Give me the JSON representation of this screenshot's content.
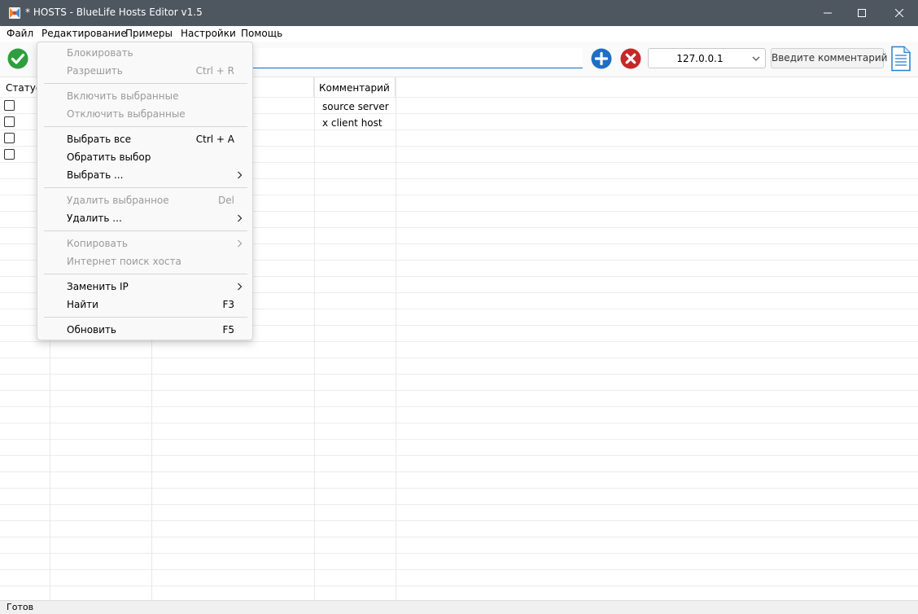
{
  "window": {
    "title": "* HOSTS - BlueLife Hosts Editor v1.5",
    "icons": {
      "app": "app-icon",
      "minimize": "minimize-icon",
      "maximize": "maximize-icon",
      "close": "close-icon"
    }
  },
  "menubar": {
    "items": [
      {
        "label": "Файл"
      },
      {
        "label": "Редактирование"
      },
      {
        "label": "Примеры"
      },
      {
        "label": "Настройки"
      },
      {
        "label": "Помощь"
      }
    ],
    "active": "Редактирование"
  },
  "toolbar": {
    "host_value": "",
    "ip_select_value": "127.0.0.1",
    "comment_button_label": "Введите комментарий",
    "icons": {
      "apply": "checkmark-icon",
      "add": "plus-icon",
      "delete": "delete-icon",
      "document": "document-icon",
      "dropdown": "chevron-down-icon"
    },
    "colors": {
      "apply": "#2e9e3e",
      "add": "#1e6fc4",
      "delete": "#c62828"
    }
  },
  "table": {
    "columns": [
      "Статус",
      "Комментарий"
    ],
    "rows": [
      {
        "checked": false,
        "comment": "source server"
      },
      {
        "checked": false,
        "comment": "x client host"
      },
      {
        "checked": false,
        "comment": ""
      },
      {
        "checked": false,
        "comment": ""
      }
    ]
  },
  "edit_menu": {
    "groups": [
      [
        {
          "label": "Блокировать",
          "shortcut": "",
          "enabled": false,
          "submenu": false
        },
        {
          "label": "Разрешить",
          "shortcut": "Ctrl + R",
          "enabled": false,
          "submenu": false
        }
      ],
      [
        {
          "label": "Включить выбранные",
          "shortcut": "",
          "enabled": false,
          "submenu": false
        },
        {
          "label": "Отключить выбранные",
          "shortcut": "",
          "enabled": false,
          "submenu": false
        }
      ],
      [
        {
          "label": "Выбрать все",
          "shortcut": "Ctrl + A",
          "enabled": true,
          "submenu": false
        },
        {
          "label": "Обратить выбор",
          "shortcut": "",
          "enabled": true,
          "submenu": false
        },
        {
          "label": "Выбрать ...",
          "shortcut": "",
          "enabled": true,
          "submenu": true
        }
      ],
      [
        {
          "label": "Удалить выбранное",
          "shortcut": "Del",
          "enabled": false,
          "submenu": false
        },
        {
          "label": "Удалить ...",
          "shortcut": "",
          "enabled": true,
          "submenu": true
        }
      ],
      [
        {
          "label": "Копировать",
          "shortcut": "",
          "enabled": false,
          "submenu": true
        },
        {
          "label": "Интернет поиск хоста",
          "shortcut": "",
          "enabled": false,
          "submenu": false
        }
      ],
      [
        {
          "label": "Заменить IP",
          "shortcut": "",
          "enabled": true,
          "submenu": true
        },
        {
          "label": "Найти",
          "shortcut": "F3",
          "enabled": true,
          "submenu": false
        }
      ],
      [
        {
          "label": "Обновить",
          "shortcut": "F5",
          "enabled": true,
          "submenu": false
        }
      ]
    ]
  },
  "statusbar": {
    "text": "Готов"
  }
}
